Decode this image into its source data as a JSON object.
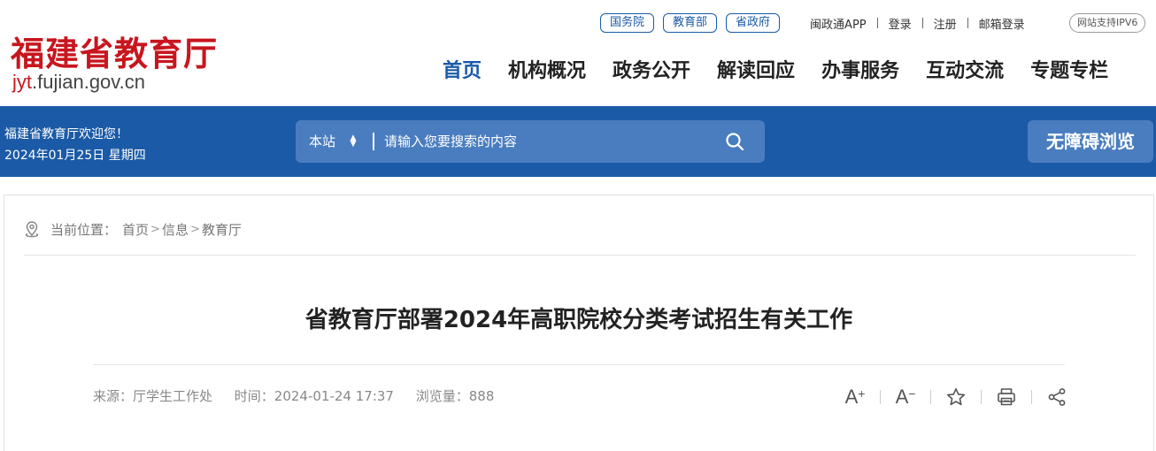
{
  "site": {
    "name": "福建省教育厅",
    "url_prefix": "jyt",
    "url_suffix": ".fujian.gov.cn"
  },
  "top_links": {
    "pills": [
      "国务院",
      "教育部",
      "省政府"
    ],
    "links": [
      "闽政通APP",
      "登录",
      "注册",
      "邮箱登录"
    ],
    "ipv6": "网站支持IPV6"
  },
  "nav": {
    "items": [
      "首页",
      "机构概况",
      "政务公开",
      "解读回应",
      "办事服务",
      "互动交流",
      "专题专栏"
    ],
    "active_index": 0
  },
  "bar": {
    "welcome": "福建省教育厅欢迎您！",
    "date": "2024年01月25日 星期四",
    "search_scope": "本站",
    "search_placeholder": "请输入您要搜索的内容",
    "accessibility_label": "无障碍浏览"
  },
  "breadcrumb": {
    "label": "当前位置：",
    "items": [
      "首页",
      "信息",
      "教育厅"
    ],
    "separator": ">"
  },
  "article": {
    "title": "省教育厅部署2024年高职院校分类考试招生有关工作",
    "source": "来源：厅学生工作处",
    "time": "时间：2024-01-24 17:37",
    "views": "浏览量：888"
  },
  "tools": {
    "font_larger": "A",
    "font_smaller": "A",
    "plus": "+",
    "minus": "−"
  },
  "colors": {
    "brand_red": "#c8161e",
    "brand_blue": "#1b5aa6",
    "search_blue": "#4a7dbf"
  },
  "icons": [
    "location-icon",
    "chevron-updown-icon",
    "search-icon",
    "font-increase-icon",
    "font-decrease-icon",
    "star-icon",
    "print-icon",
    "share-icon"
  ]
}
